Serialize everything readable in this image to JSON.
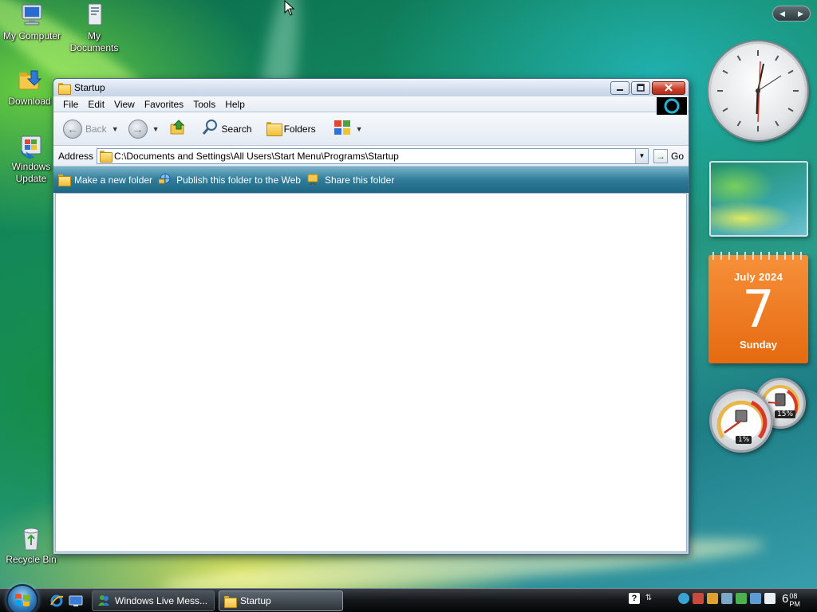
{
  "desktop": {
    "icons": [
      {
        "label": "My Computer",
        "icon": "computer-icon"
      },
      {
        "label": "My Documents",
        "icon": "documents-icon"
      },
      {
        "label": "Download",
        "icon": "download-icon"
      },
      {
        "label": "Windows Update",
        "icon": "windows-update-icon"
      },
      {
        "label": "Recycle Bin",
        "icon": "recycle-bin-icon"
      }
    ]
  },
  "window": {
    "title": "Startup",
    "menu": [
      "File",
      "Edit",
      "View",
      "Favorites",
      "Tools",
      "Help"
    ],
    "toolbar": {
      "back_label": "Back",
      "search_label": "Search",
      "folders_label": "Folders"
    },
    "address": {
      "label": "Address",
      "value": "C:\\Documents and Settings\\All Users\\Start Menu\\Programs\\Startup",
      "go_label": "Go"
    },
    "tasks": [
      "Make a new folder",
      "Publish this folder to the Web",
      "Share this folder"
    ]
  },
  "gadgets": {
    "calendar": {
      "month": "July 2024",
      "day": "7",
      "weekday": "Sunday"
    },
    "meters": {
      "cpu_label": "1%",
      "memory_label": "15%",
      "cpu_value": 1,
      "memory_value": 15
    }
  },
  "taskbar": {
    "buttons": [
      {
        "label": "Windows Live Mess...",
        "icon": "messenger-icon"
      },
      {
        "label": "Startup",
        "icon": "folder-icon"
      }
    ],
    "clock": {
      "hour": "6",
      "minutes": "08",
      "ampm": "PM"
    }
  },
  "colors": {
    "accent": "#2f7c99",
    "calendar": "#e56a10",
    "close_button": "#c9412c"
  }
}
